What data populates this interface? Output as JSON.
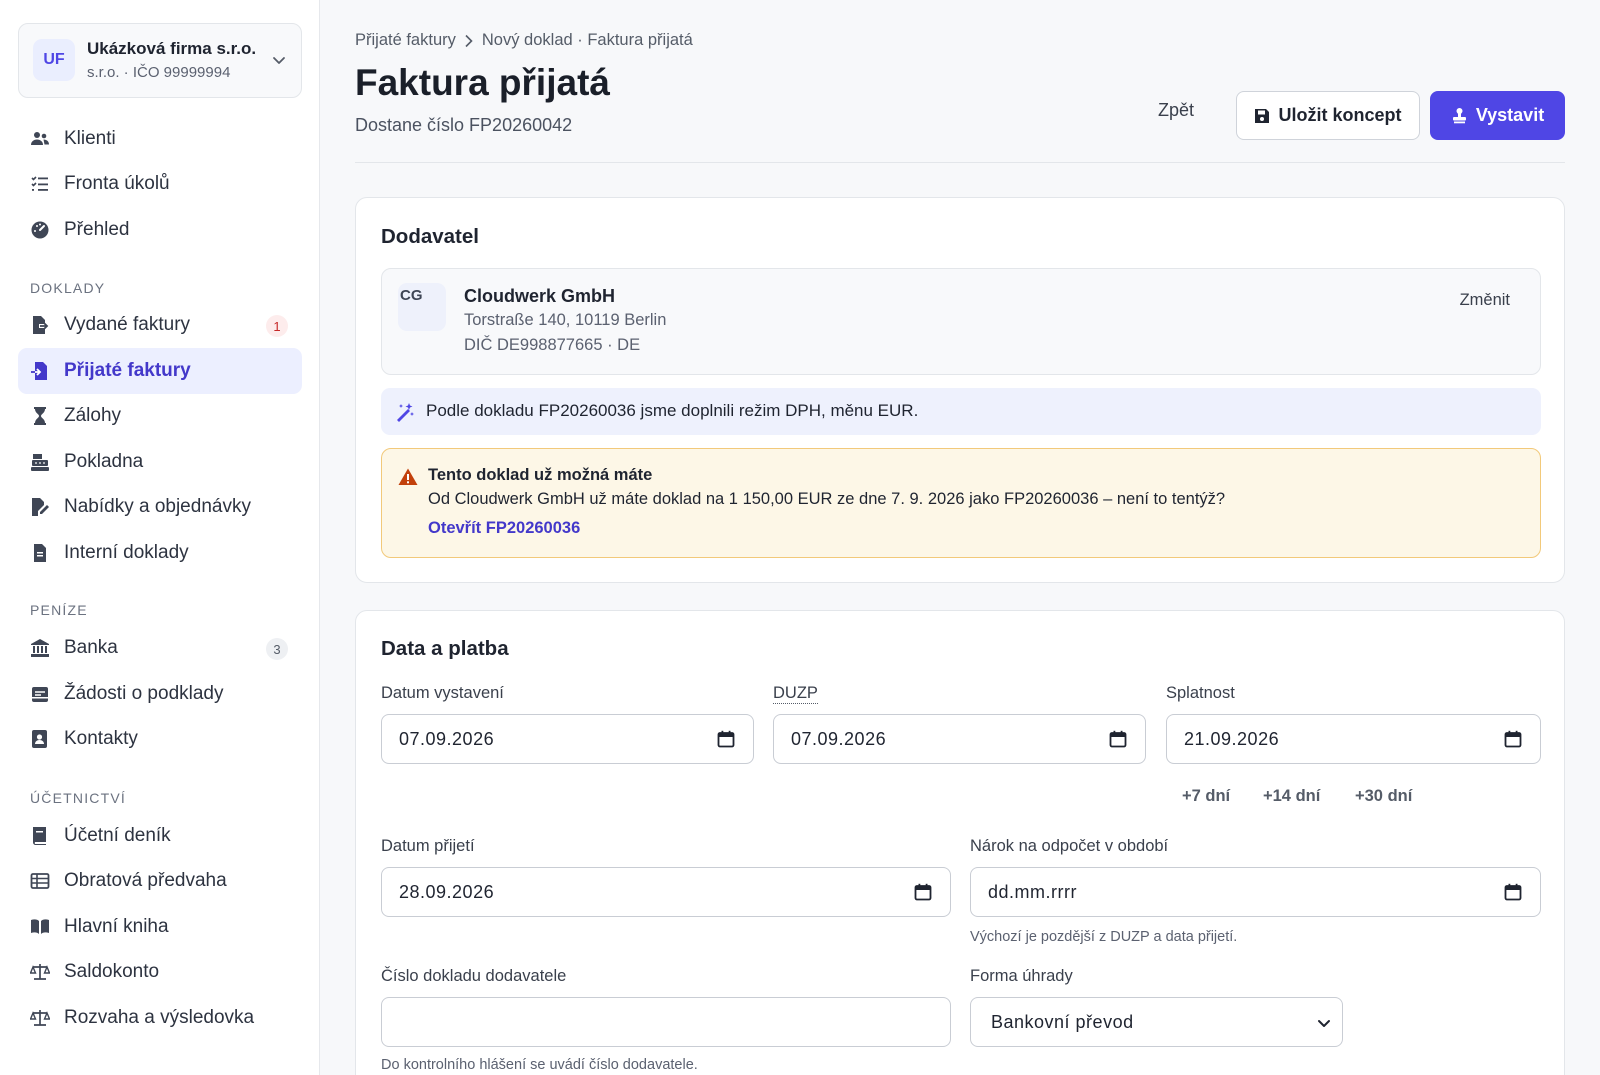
{
  "company": {
    "initials": "UF",
    "name": "Ukázková firma s.r.o.",
    "sub": "s.r.o. · IČO 99999994"
  },
  "nav": {
    "top": [
      {
        "label": "Klienti"
      },
      {
        "label": "Fronta úkolů"
      },
      {
        "label": "Přehled"
      }
    ],
    "section_doklady": "DOKLADY",
    "doklady": [
      {
        "label": "Vydané faktury",
        "badge": "1"
      },
      {
        "label": "Přijaté faktury"
      },
      {
        "label": "Zálohy"
      },
      {
        "label": "Pokladna"
      },
      {
        "label": "Nabídky a objednávky"
      },
      {
        "label": "Interní doklady"
      }
    ],
    "section_penize": "PENÍZE",
    "penize": [
      {
        "label": "Banka",
        "badge": "3"
      },
      {
        "label": "Žádosti o podklady"
      },
      {
        "label": "Kontakty"
      }
    ],
    "section_ucetnictvi": "ÚČETNICTVÍ",
    "ucetnictvi": [
      {
        "label": "Účetní deník"
      },
      {
        "label": "Obratová předvaha"
      },
      {
        "label": "Hlavní kniha"
      },
      {
        "label": "Saldokonto"
      },
      {
        "label": "Rozvaha a výsledovka"
      }
    ]
  },
  "header": {
    "breadcrumb_parent": "Přijaté faktury",
    "breadcrumb_current": "Nový doklad · Faktura přijatá",
    "title": "Faktura přijatá",
    "subtitle": "Dostane číslo FP20260042",
    "back_label": "Zpět",
    "save_label": "Uložit koncept",
    "issue_label": "Vystavit"
  },
  "supplier_card": {
    "heading": "Dodavatel",
    "initials": "CG",
    "name": "Cloudwerk GmbH",
    "address": "Torstraße 140, 10119 Berlin",
    "tax": "DIČ DE998877665 · DE",
    "change_label": "Změnit",
    "info_text": "Podle dokladu FP20260036 jsme doplnili režim DPH, měnu EUR.",
    "warning_title": "Tento doklad už možná máte",
    "warning_text": "Od Cloudwerk GmbH už máte doklad na 1 150,00 EUR ze dne 7. 9. 2026 jako FP20260036 – není to tentýž?",
    "warning_link": "Otevřít FP20260036"
  },
  "payment_card": {
    "heading": "Data a platba",
    "issue_date_label": "Datum vystavení",
    "issue_date": "07.09.2026",
    "duzp_label": "DUZP",
    "duzp": "07.09.2026",
    "due_label": "Splatnost",
    "due": "21.09.2026",
    "quick": [
      "+7 dní",
      "+14 dní",
      "+30 dní"
    ],
    "received_label": "Datum přijetí",
    "received": "28.09.2026",
    "deduction_label": "Nárok na odpočet v období",
    "deduction_placeholder": "dd.mm.rrrr",
    "deduction_hint": "Výchozí je pozdější z DUZP a data přijetí.",
    "supplier_no_label": "Číslo dokladu dodavatele",
    "supplier_no": "",
    "supplier_no_hint": "Do kontrolního hlášení se uvádí číslo dodavatele.",
    "payment_label": "Forma úhrady",
    "payment_value": "Bankovní převod"
  },
  "colors": {
    "accent": "#4f46e5",
    "active_bg": "#ecefff",
    "warning_bg": "#fdf7e7",
    "warning_border": "#f2c97a",
    "info_bg": "#eef1fd"
  }
}
